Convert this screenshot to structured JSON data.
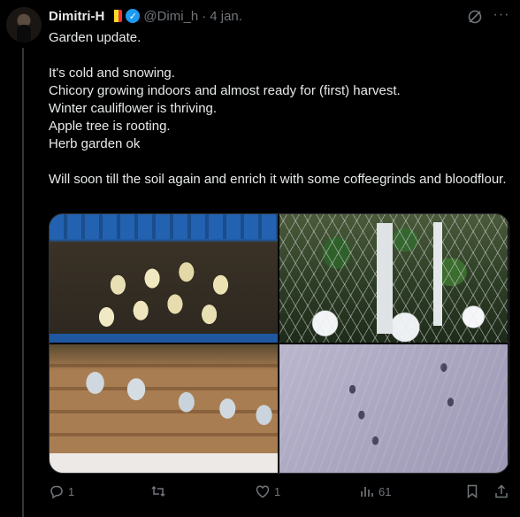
{
  "post": {
    "author_name": "Dimitri-H",
    "handle": "@Dimi_h",
    "separator": "·",
    "date": "4 jan.",
    "flag_colors": [
      "#000000",
      "#FDDA24",
      "#EF3340"
    ],
    "verified_icon": "verified-badge-icon",
    "text_paragraphs": [
      "Garden update.",
      "",
      "It's cold and snowing.",
      "Chicory growing indoors and almost ready for (first) harvest.",
      "Winter cauliflower is thriving.",
      "Apple tree is rooting.",
      "Herb garden ok",
      "",
      "Will soon till the soil again and enrich it with some coffeegrinds and bloodflour."
    ]
  },
  "media": {
    "photos": [
      {
        "subject": "chicory-in-blue-crate"
      },
      {
        "subject": "cauliflower-under-netting-in-snow"
      },
      {
        "subject": "herb-garden-pallet-cans"
      },
      {
        "subject": "paw-prints-in-snow"
      }
    ]
  },
  "actions": {
    "reply_count": "1",
    "repost_count": "",
    "like_count": "1",
    "views_count": "61"
  },
  "colors": {
    "background": "#000000",
    "text": "#e7e9ea",
    "muted": "#71767b",
    "verified": "#1d9bf0",
    "divider": "#2f3336"
  }
}
